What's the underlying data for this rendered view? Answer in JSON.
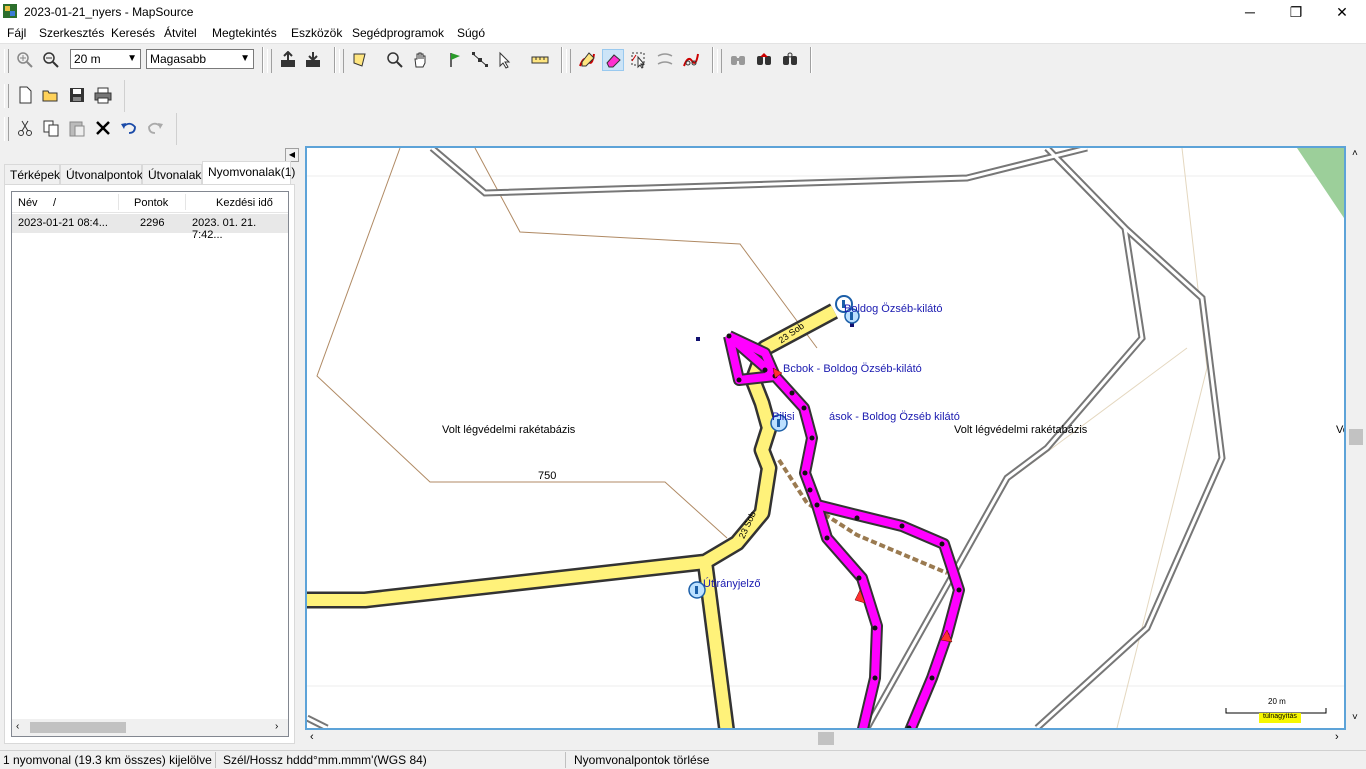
{
  "window": {
    "title": "2023-01-21_nyers - MapSource",
    "minimize": "─",
    "maximize": "❐",
    "close": "✕"
  },
  "menu": [
    "Fájl",
    "Szerkesztés",
    "Keresés",
    "Átvitel",
    "Megtekintés",
    "Eszközök",
    "Segédprogramok",
    "Súgó"
  ],
  "toolbar": {
    "zoom_value": "20 m",
    "detail_value": "Magasabb"
  },
  "tabs": [
    "Térképek",
    "Útvonalpontok",
    "Útvonalak",
    "Nyomvonalak(1)"
  ],
  "selected_tab": "Nyomvonalak(1)",
  "table": {
    "headers": {
      "name": "Név",
      "sort": "/",
      "points": "Pontok",
      "start": "Kezdési idő"
    },
    "rows": [
      {
        "name": "2023-01-21 08:4...",
        "points": "2296",
        "start": "2023. 01. 21. 7:42..."
      }
    ]
  },
  "map": {
    "labels": {
      "poi1": "Boldog Özséb-kilátó",
      "poi2": "Bcbok - Boldog Özséb-kilátó",
      "poi3a": "Pilisi",
      "poi3b": "ások - Boldog Özséb kilátó",
      "area_left": "Volt légvédelmi rakétabázis",
      "area_right": "Volt légvédelmi rakétabázis",
      "area_edge": "Vo",
      "contour": "750",
      "road1": "23 Sob",
      "road2": "23 Sob",
      "signpost": "Útirányjelző",
      "scale": "20 m",
      "scale_note": "túlnagyítás"
    },
    "colors": {
      "track": "#ff00ff",
      "road": "#fff27a",
      "contour": "#b08a64"
    }
  },
  "status": {
    "selection": "1 nyomvonal (19.3 km összes) kijelölve",
    "coord_format": "Szél/Hossz hddd°mm.mmm'(WGS 84)",
    "action": "Nyomvonalpontok törlése"
  }
}
